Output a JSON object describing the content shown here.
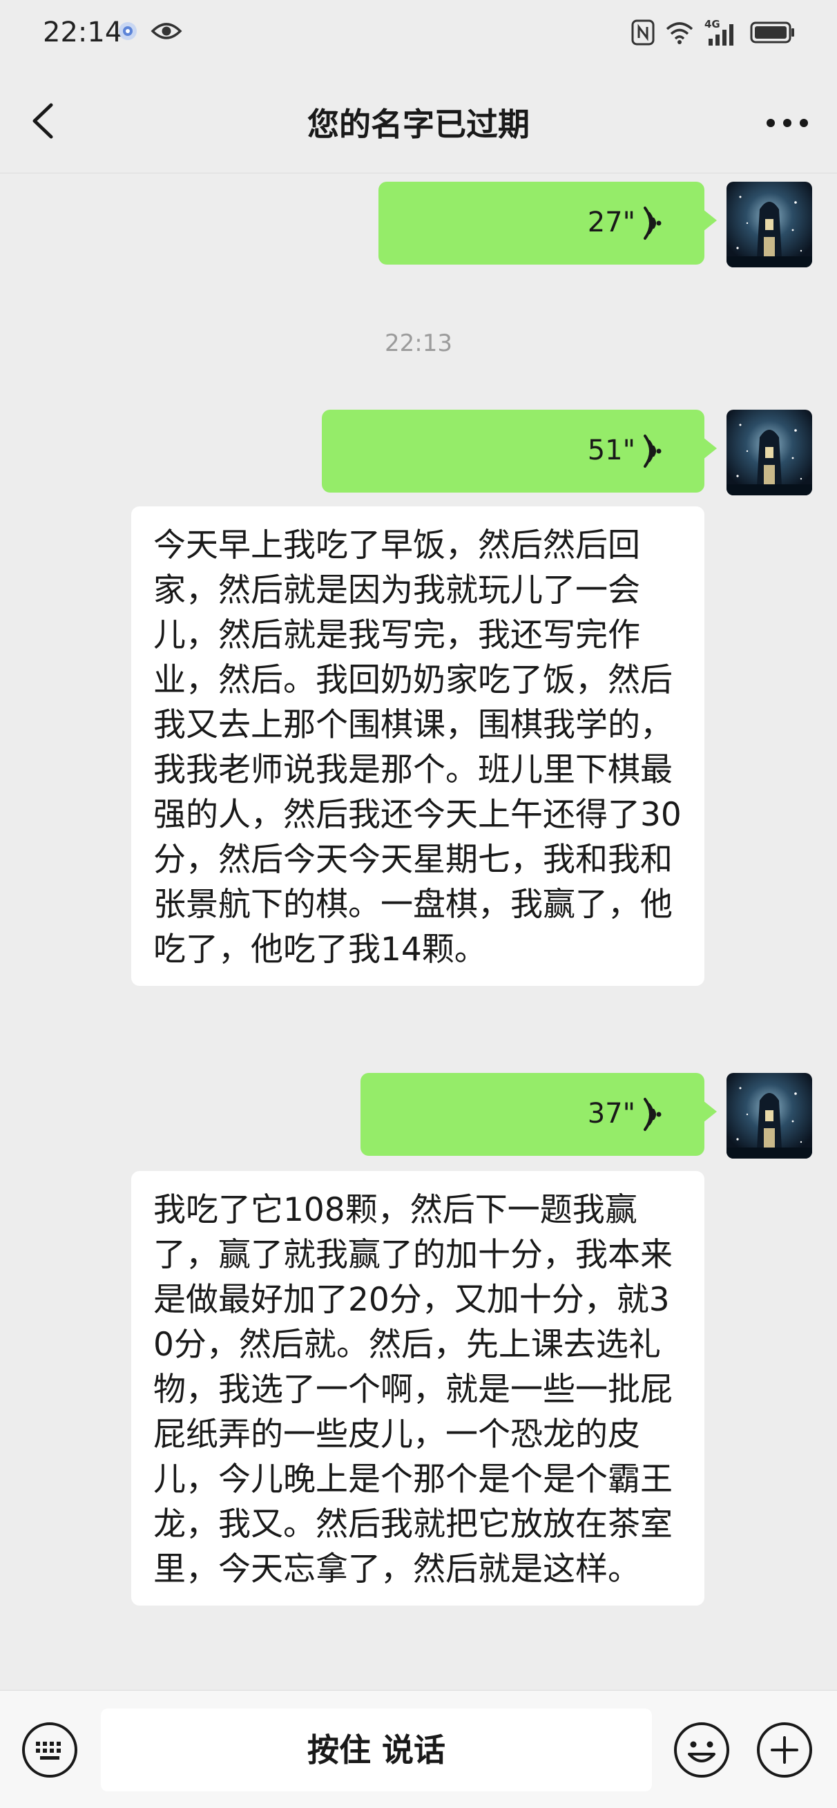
{
  "status_bar": {
    "time": "22:14",
    "network": "4G"
  },
  "header": {
    "title": "您的名字已过期"
  },
  "messages": [
    {
      "type": "voice",
      "duration": "27\""
    },
    {
      "type": "timestamp",
      "text": "22:13"
    },
    {
      "type": "voice",
      "duration": "51\""
    },
    {
      "type": "transcript",
      "text": "今天早上我吃了早饭，然后然后回家，然后就是因为我就玩儿了一会儿，然后就是我写完，我还写完作业，然后。我回奶奶家吃了饭，然后我又去上那个围棋课，围棋我学的，我我老师说我是那个。班儿里下棋最强的人，然后我还今天上午还得了30分，然后今天今天星期七，我和我和张景航下的棋。一盘棋，我赢了，他吃了，他吃了我14颗。"
    },
    {
      "type": "voice",
      "duration": "37\""
    },
    {
      "type": "transcript",
      "text": "我吃了它108颗，然后下一题我赢了，赢了就我赢了的加十分，我本来是做最好加了20分，又加十分，就30分，然后就。然后，先上课去选礼物，我选了一个啊，就是一些一批屁屁纸弄的一些皮儿，一个恐龙的皮儿，今儿晚上是个那个是个是个霸王龙，我又。然后我就把它放放在茶室里，今天忘拿了，然后就是这样。"
    }
  ],
  "input_bar": {
    "hold_to_talk": "按住 说话"
  },
  "colors": {
    "background": "#ededed",
    "voice_bubble": "#95ec69",
    "text_bubble": "#ffffff"
  }
}
